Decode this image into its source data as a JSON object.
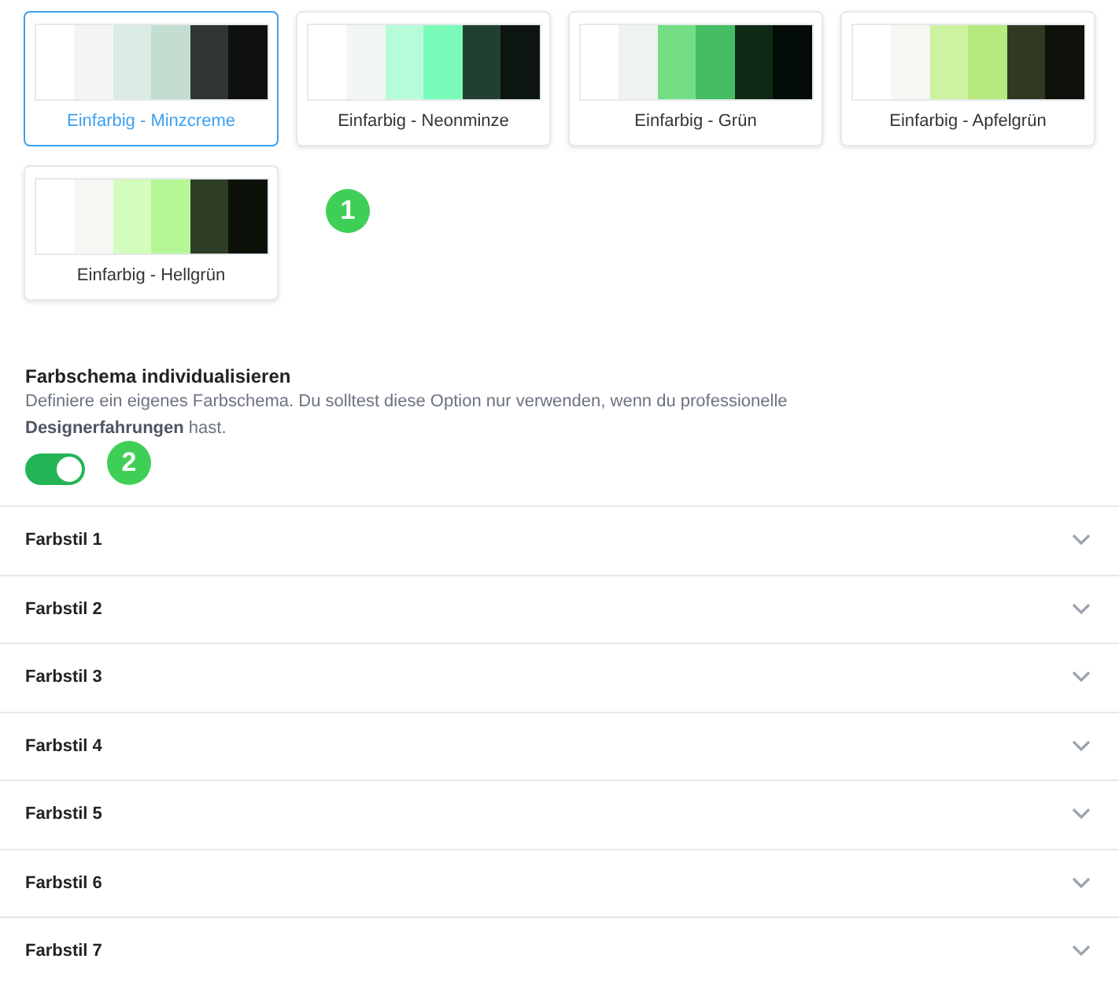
{
  "themes": [
    {
      "label": "Einfarbig - Minzcreme",
      "selected": true,
      "swatches": [
        {
          "color": "#ffffff"
        },
        {
          "color": "#f4f6f5"
        },
        {
          "color": "#d9ebe2"
        },
        {
          "color": "#c3ddd0"
        },
        {
          "color": "#2e3532"
        },
        {
          "color": "#0f1110"
        }
      ]
    },
    {
      "label": "Einfarbig - Neonminze",
      "selected": false,
      "swatches": [
        {
          "color": "#ffffff"
        },
        {
          "color": "#f2f7f5"
        },
        {
          "color": "#b6fcd9"
        },
        {
          "color": "#7bfbba"
        },
        {
          "color": "#214032"
        },
        {
          "color": "#0c1510"
        }
      ]
    },
    {
      "label": "Einfarbig - Grün",
      "selected": false,
      "swatches": [
        {
          "color": "#ffffff"
        },
        {
          "color": "#eef3f0"
        },
        {
          "color": "#73de84"
        },
        {
          "color": "#44bd63"
        },
        {
          "color": "#0e2a16"
        },
        {
          "color": "#040c07"
        }
      ]
    },
    {
      "label": "Einfarbig - Apfelgrün",
      "selected": false,
      "swatches": [
        {
          "color": "#ffffff"
        },
        {
          "color": "#f4f7f2"
        },
        {
          "color": "#cdf2a0"
        },
        {
          "color": "#b6ea7e"
        },
        {
          "color": "#303a22"
        },
        {
          "color": "#0e120b"
        }
      ]
    },
    {
      "label": "Einfarbig - Hellgrün",
      "selected": false,
      "swatches": [
        {
          "color": "#ffffff"
        },
        {
          "color": "#f4f7f2"
        },
        {
          "color": "#d3fdbc"
        },
        {
          "color": "#b5f797"
        },
        {
          "color": "#2d3d26"
        },
        {
          "color": "#0c120a"
        }
      ]
    }
  ],
  "custom": {
    "title": "Farbschema individualisieren",
    "description": "Definiere ein eigenes Farbschema. Du solltest diese Option nur verwenden, wenn du professionelle **Designerfahrungen** hast.",
    "toggle": {
      "on": true
    }
  },
  "styles": [
    {
      "label": "Farbstil 1",
      "expanded": false
    },
    {
      "label": "Farbstil 2",
      "expanded": false
    },
    {
      "label": "Farbstil 3",
      "expanded": false
    },
    {
      "label": "Farbstil 4",
      "expanded": false
    },
    {
      "label": "Farbstil 5",
      "expanded": false
    },
    {
      "label": "Farbstil 6",
      "expanded": false
    },
    {
      "label": "Farbstil 7",
      "expanded": false
    }
  ],
  "annotations": [
    "1",
    "2"
  ]
}
